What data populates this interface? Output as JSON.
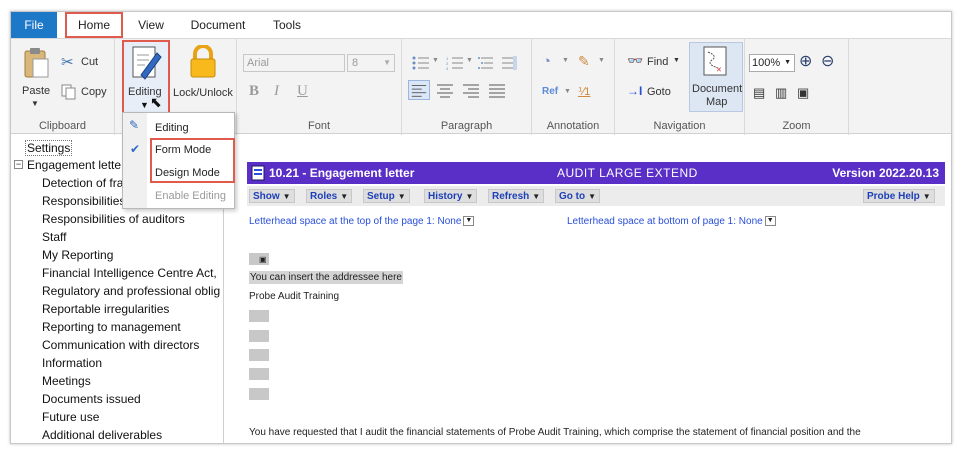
{
  "menu": {
    "tabs": [
      "File",
      "Home",
      "View",
      "Document",
      "Tools"
    ]
  },
  "ribbon": {
    "clipboard": {
      "paste": "Paste",
      "cut": "Cut",
      "copy": "Copy",
      "label": "Clipboard"
    },
    "editing": {
      "editing": "Editing",
      "lock_unlock": "Lock/Unlock"
    },
    "font": {
      "name": "Arial",
      "size": "8",
      "bold": "B",
      "italic": "I",
      "underline": "U",
      "label": "Font"
    },
    "paragraph": {
      "label": "Paragraph"
    },
    "annotation": {
      "label": "Annotation"
    },
    "navigation": {
      "find": "Find",
      "goto": "Goto",
      "document_map_line1": "Document",
      "document_map_line2": "Map",
      "label": "Navigation"
    },
    "zoom": {
      "level": "100%",
      "label": "Zoom"
    }
  },
  "editing_dropdown": {
    "items": [
      "Editing",
      "Form Mode",
      "Design Mode",
      "Enable Editing"
    ]
  },
  "tree": {
    "items": [
      "Settings",
      "Engagement lette",
      "Detection of fra",
      "Responsibilities",
      "Responsibilities of auditors",
      "Staff",
      "My Reporting",
      "Financial Intelligence Centre Act,",
      "Regulatory and professional oblig",
      "Reportable irregularities",
      "Reporting to management",
      "Communication with directors",
      "Information",
      "Meetings",
      "Documents issued",
      "Future use",
      "Additional deliverables"
    ]
  },
  "document": {
    "title": "10.21 - Engagement letter",
    "subtitle": "AUDIT LARGE EXTEND",
    "version": "Version 2022.20.13",
    "toolbar": [
      "Show",
      "Roles",
      "Setup",
      "History",
      "Refresh",
      "Go to",
      "Probe Help"
    ],
    "letterhead_top": "Letterhead space at the top of the page 1: None",
    "letterhead_bottom": "Letterhead space at bottom of page 1: None",
    "addressee_placeholder": "You can insert the addressee here",
    "client_name": "Probe Audit Training",
    "paragraph": "You have requested that I audit the financial statements of Probe Audit Training, which comprise the statement of financial position and the"
  },
  "colors": {
    "accent": "#1e78c8",
    "highlight": "#e05a4e",
    "doc_header": "#5a2fc8",
    "link_blue": "#2a4fd8"
  }
}
